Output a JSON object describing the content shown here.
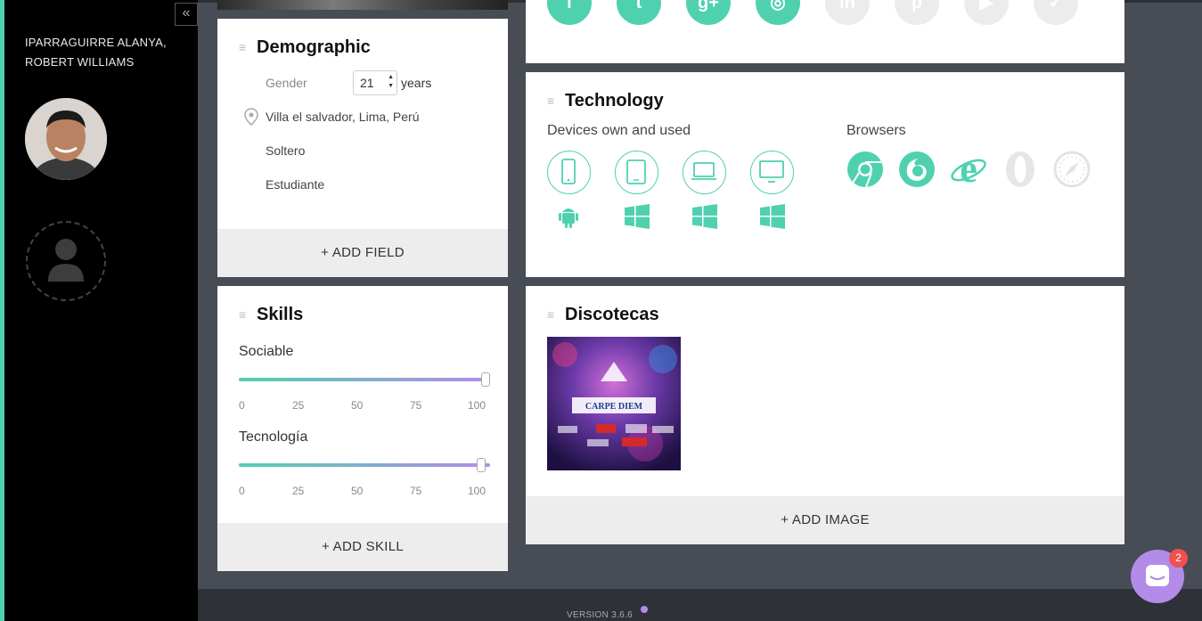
{
  "sidebar": {
    "collapse_label": "«",
    "user_name": "IPARRAGUIRRE ALANYA, ROBERT WILLIAMS"
  },
  "social": {
    "icons": [
      {
        "name": "facebook-icon",
        "glyph": "f",
        "active": true
      },
      {
        "name": "twitter-icon",
        "glyph": "t",
        "active": true
      },
      {
        "name": "google-plus-icon",
        "glyph": "g+",
        "active": true
      },
      {
        "name": "instagram-icon",
        "glyph": "◎",
        "active": true
      },
      {
        "name": "linkedin-icon",
        "glyph": "in",
        "active": false
      },
      {
        "name": "pinterest-icon",
        "glyph": "p",
        "active": false
      },
      {
        "name": "youtube-icon",
        "glyph": "▶",
        "active": false
      },
      {
        "name": "foursquare-icon",
        "glyph": "✓",
        "active": false
      }
    ]
  },
  "demographic": {
    "title": "Demographic",
    "gender_label": "Gender",
    "age_value": "21",
    "age_unit": "years",
    "location": "Villa el salvador, Lima, Perú",
    "marital_status": "Soltero",
    "occupation": "Estudiante",
    "add_label": "+ ADD FIELD"
  },
  "technology": {
    "title": "Technology",
    "devices_label": "Devices own and used",
    "browsers_label": "Browsers",
    "devices": [
      "smartphone-icon",
      "tablet-icon",
      "laptop-icon",
      "desktop-icon"
    ],
    "os": [
      "android-icon",
      "windows-icon",
      "windows-icon",
      "windows-icon"
    ],
    "browsers": [
      {
        "name": "chrome-icon",
        "active": true
      },
      {
        "name": "firefox-icon",
        "active": true
      },
      {
        "name": "internet-explorer-icon",
        "active": true
      },
      {
        "name": "opera-icon",
        "active": false
      },
      {
        "name": "safari-icon",
        "active": false
      }
    ]
  },
  "skills": {
    "title": "Skills",
    "items": [
      {
        "label": "Sociable",
        "value": 100
      },
      {
        "label": "Tecnología",
        "value": 98
      }
    ],
    "ticks": [
      "0",
      "25",
      "50",
      "75",
      "100"
    ],
    "add_label": "+ ADD SKILL"
  },
  "discotecas": {
    "title": "Discotecas",
    "image_alt": "CARPE DIEM",
    "add_label": "+ ADD IMAGE"
  },
  "footer": {
    "version": "VERSION 3.6.6"
  },
  "chat": {
    "badge": "2"
  },
  "colors": {
    "accent": "#4fd1b0",
    "purple": "#b38be8",
    "badge": "#f0504f"
  }
}
